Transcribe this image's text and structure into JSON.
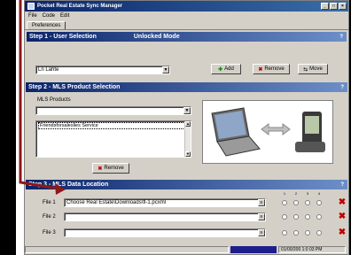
{
  "window": {
    "title": "Pocket Real Estate Sync Manager"
  },
  "menu": [
    "File",
    "Code",
    "Edit"
  ],
  "tab": "Preferences",
  "step1": {
    "title": "Step 1 - User Selection",
    "mode": "Unlocked Mode",
    "user_value": "Ln Lahte",
    "add_label": "Add",
    "remove_label": "Remove",
    "more_label": "Move"
  },
  "step2": {
    "title": "Step 2 - MLS Product Selection",
    "products_label": "MLS Products",
    "list_item": "Friendsforsaleslies Service",
    "remove_label": "Remove"
  },
  "step3": {
    "title": "Step 3 - MLS Data Location",
    "columns": [
      "1",
      "2",
      "3",
      "4"
    ],
    "files": [
      {
        "label": "File 1",
        "value": "Choose Real Estate\\Downloads\\fl-1.pcxml"
      },
      {
        "label": "File 2",
        "value": ""
      },
      {
        "label": "File 3",
        "value": ""
      }
    ]
  },
  "status": {
    "right_text": "01/00/200 1:0 03 PM"
  },
  "colors": {
    "step_header": "#0a246a",
    "arrow": "#8b1a1a",
    "progress": "#1e1e8c"
  }
}
